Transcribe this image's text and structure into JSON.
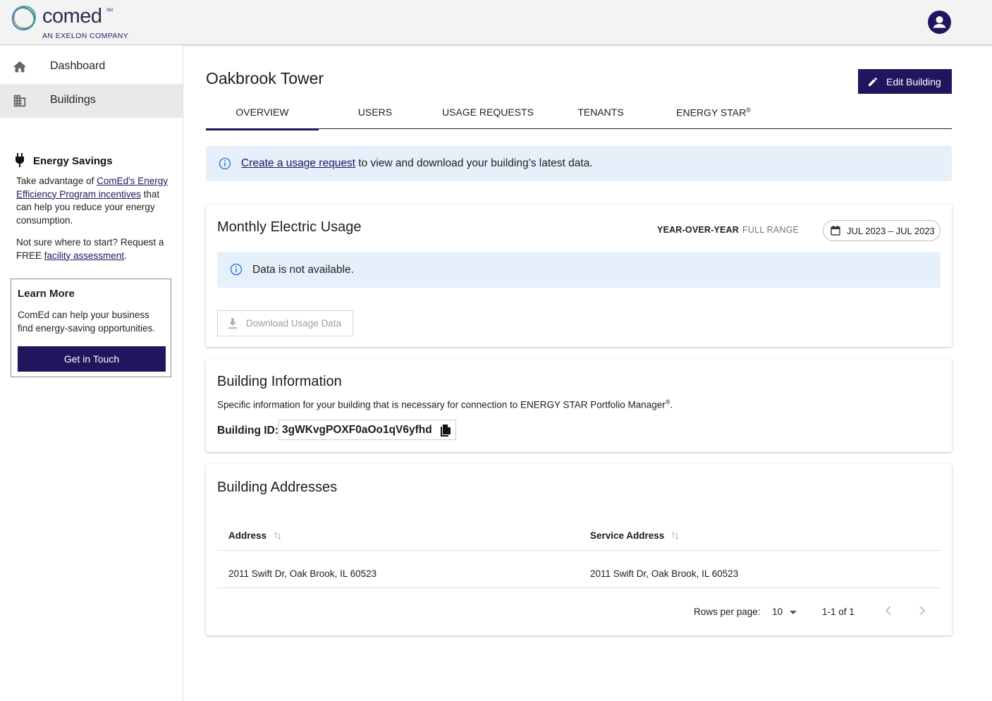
{
  "header": {
    "logo_text": "comed",
    "logo_sm": "SM",
    "logo_sub": "AN EXELON COMPANY"
  },
  "sidebar": {
    "items": [
      {
        "label": "Dashboard",
        "icon": "home-icon",
        "active": false
      },
      {
        "label": "Buildings",
        "icon": "building-icon",
        "active": true
      }
    ],
    "savings": {
      "title": "Energy Savings",
      "p1_pre": "Take advantage of ",
      "p1_link": "ComEd's Energy Efficiency Program incentives",
      "p1_post": " that can help you reduce your energy consumption.",
      "p2_pre": "Not sure where to start? Request a FREE ",
      "p2_link": "facility assessment",
      "p2_post": "."
    },
    "learn_more": {
      "title": "Learn More",
      "body": "ComEd can help your business find energy-saving opportunities.",
      "button": "Get in Touch"
    }
  },
  "page": {
    "title": "Oakbrook Tower",
    "edit_button": "Edit Building"
  },
  "tabs": [
    {
      "label": "OVERVIEW",
      "active": true
    },
    {
      "label": "USERS",
      "active": false
    },
    {
      "label": "USAGE REQUESTS",
      "active": false
    },
    {
      "label": "TENANTS",
      "active": false
    },
    {
      "label": "ENERGY STAR",
      "sup": "®",
      "active": false
    }
  ],
  "info_banner": {
    "link": "Create a usage request",
    "text": " to view and download your building’s latest data."
  },
  "usage": {
    "title": "Monthly Electric Usage",
    "toggle_on": "YEAR-OVER-YEAR",
    "toggle_off": "FULL RANGE",
    "date_range": "JUL 2023 – JUL 2023",
    "notice": "Data is not available.",
    "download": "Download Usage Data"
  },
  "building_info": {
    "title": "Building Information",
    "desc": "Specific information for your building that is necessary for connection to ENERGY STAR Portfolio Manager",
    "desc_sup": "®",
    "desc_end": ".",
    "id_label": "Building ID:",
    "id_value": "3gWKvgPOXF0aOo1qV6yfhd"
  },
  "addresses": {
    "title": "Building Addresses",
    "columns": [
      "Address",
      "Service Address"
    ],
    "rows": [
      [
        "2011 Swift Dr, Oak Brook, IL 60523",
        "2011 Swift Dr, Oak Brook, IL 60523"
      ]
    ],
    "rows_per_page_label": "Rows per page:",
    "rows_per_page": "10",
    "range": "1-1 of 1"
  },
  "colors": {
    "brand": "#1f165e",
    "info_bg": "#e6f0fb",
    "info_icon": "#3b7dd8"
  }
}
